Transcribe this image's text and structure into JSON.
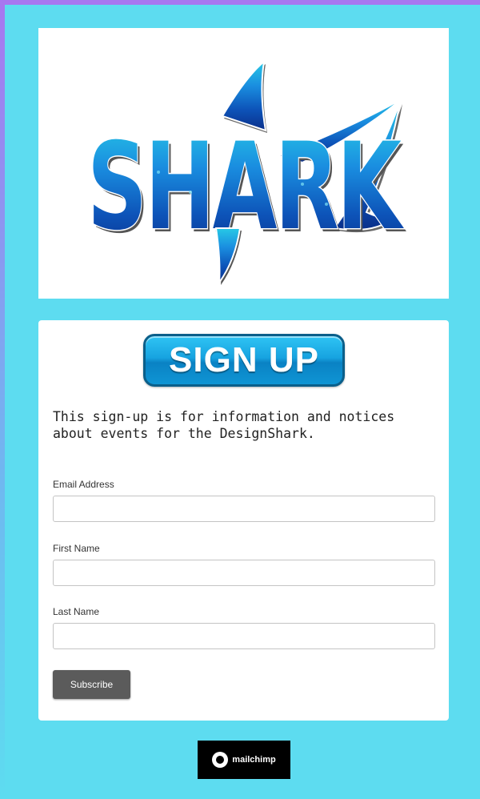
{
  "colors": {
    "page_background": "#5ddcf0",
    "frame_accent": "#a777f0",
    "signup_button": "#17a3e0",
    "subscribe_button": "#5b5b5b",
    "shark_logo": "#0d53b8"
  },
  "logo": {
    "text": "SHARK"
  },
  "signup": {
    "label": "SIGN UP"
  },
  "intro": {
    "text": "This sign-up is for information and notices about events for the DesignShark."
  },
  "form": {
    "email": {
      "label": "Email Address",
      "value": "",
      "placeholder": ""
    },
    "first_name": {
      "label": "First Name",
      "value": "",
      "placeholder": ""
    },
    "last_name": {
      "label": "Last Name",
      "value": "",
      "placeholder": ""
    },
    "subscribe_label": "Subscribe"
  },
  "footer": {
    "badge_text": "mailchimp",
    "badge_icon": "mailchimp-icon"
  }
}
